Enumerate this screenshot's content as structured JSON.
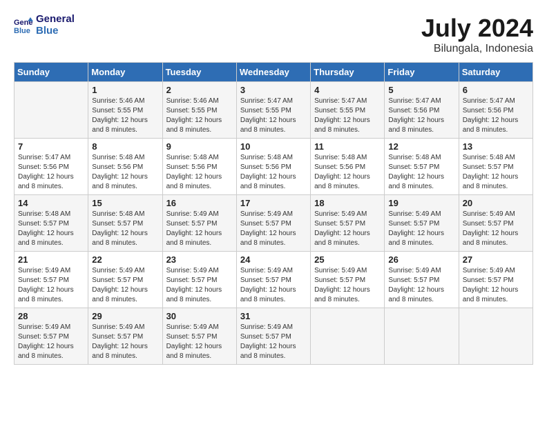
{
  "logo": {
    "line1": "General",
    "line2": "Blue"
  },
  "title": {
    "month_year": "July 2024",
    "location": "Bilungala, Indonesia"
  },
  "days_of_week": [
    "Sunday",
    "Monday",
    "Tuesday",
    "Wednesday",
    "Thursday",
    "Friday",
    "Saturday"
  ],
  "weeks": [
    [
      {
        "day": "",
        "info": ""
      },
      {
        "day": "1",
        "info": "Sunrise: 5:46 AM\nSunset: 5:55 PM\nDaylight: 12 hours\nand 8 minutes."
      },
      {
        "day": "2",
        "info": "Sunrise: 5:46 AM\nSunset: 5:55 PM\nDaylight: 12 hours\nand 8 minutes."
      },
      {
        "day": "3",
        "info": "Sunrise: 5:47 AM\nSunset: 5:55 PM\nDaylight: 12 hours\nand 8 minutes."
      },
      {
        "day": "4",
        "info": "Sunrise: 5:47 AM\nSunset: 5:55 PM\nDaylight: 12 hours\nand 8 minutes."
      },
      {
        "day": "5",
        "info": "Sunrise: 5:47 AM\nSunset: 5:56 PM\nDaylight: 12 hours\nand 8 minutes."
      },
      {
        "day": "6",
        "info": "Sunrise: 5:47 AM\nSunset: 5:56 PM\nDaylight: 12 hours\nand 8 minutes."
      }
    ],
    [
      {
        "day": "7",
        "info": "Sunrise: 5:47 AM\nSunset: 5:56 PM\nDaylight: 12 hours\nand 8 minutes."
      },
      {
        "day": "8",
        "info": "Sunrise: 5:48 AM\nSunset: 5:56 PM\nDaylight: 12 hours\nand 8 minutes."
      },
      {
        "day": "9",
        "info": "Sunrise: 5:48 AM\nSunset: 5:56 PM\nDaylight: 12 hours\nand 8 minutes."
      },
      {
        "day": "10",
        "info": "Sunrise: 5:48 AM\nSunset: 5:56 PM\nDaylight: 12 hours\nand 8 minutes."
      },
      {
        "day": "11",
        "info": "Sunrise: 5:48 AM\nSunset: 5:56 PM\nDaylight: 12 hours\nand 8 minutes."
      },
      {
        "day": "12",
        "info": "Sunrise: 5:48 AM\nSunset: 5:57 PM\nDaylight: 12 hours\nand 8 minutes."
      },
      {
        "day": "13",
        "info": "Sunrise: 5:48 AM\nSunset: 5:57 PM\nDaylight: 12 hours\nand 8 minutes."
      }
    ],
    [
      {
        "day": "14",
        "info": "Sunrise: 5:48 AM\nSunset: 5:57 PM\nDaylight: 12 hours\nand 8 minutes."
      },
      {
        "day": "15",
        "info": "Sunrise: 5:48 AM\nSunset: 5:57 PM\nDaylight: 12 hours\nand 8 minutes."
      },
      {
        "day": "16",
        "info": "Sunrise: 5:49 AM\nSunset: 5:57 PM\nDaylight: 12 hours\nand 8 minutes."
      },
      {
        "day": "17",
        "info": "Sunrise: 5:49 AM\nSunset: 5:57 PM\nDaylight: 12 hours\nand 8 minutes."
      },
      {
        "day": "18",
        "info": "Sunrise: 5:49 AM\nSunset: 5:57 PM\nDaylight: 12 hours\nand 8 minutes."
      },
      {
        "day": "19",
        "info": "Sunrise: 5:49 AM\nSunset: 5:57 PM\nDaylight: 12 hours\nand 8 minutes."
      },
      {
        "day": "20",
        "info": "Sunrise: 5:49 AM\nSunset: 5:57 PM\nDaylight: 12 hours\nand 8 minutes."
      }
    ],
    [
      {
        "day": "21",
        "info": "Sunrise: 5:49 AM\nSunset: 5:57 PM\nDaylight: 12 hours\nand 8 minutes."
      },
      {
        "day": "22",
        "info": "Sunrise: 5:49 AM\nSunset: 5:57 PM\nDaylight: 12 hours\nand 8 minutes."
      },
      {
        "day": "23",
        "info": "Sunrise: 5:49 AM\nSunset: 5:57 PM\nDaylight: 12 hours\nand 8 minutes."
      },
      {
        "day": "24",
        "info": "Sunrise: 5:49 AM\nSunset: 5:57 PM\nDaylight: 12 hours\nand 8 minutes."
      },
      {
        "day": "25",
        "info": "Sunrise: 5:49 AM\nSunset: 5:57 PM\nDaylight: 12 hours\nand 8 minutes."
      },
      {
        "day": "26",
        "info": "Sunrise: 5:49 AM\nSunset: 5:57 PM\nDaylight: 12 hours\nand 8 minutes."
      },
      {
        "day": "27",
        "info": "Sunrise: 5:49 AM\nSunset: 5:57 PM\nDaylight: 12 hours\nand 8 minutes."
      }
    ],
    [
      {
        "day": "28",
        "info": "Sunrise: 5:49 AM\nSunset: 5:57 PM\nDaylight: 12 hours\nand 8 minutes."
      },
      {
        "day": "29",
        "info": "Sunrise: 5:49 AM\nSunset: 5:57 PM\nDaylight: 12 hours\nand 8 minutes."
      },
      {
        "day": "30",
        "info": "Sunrise: 5:49 AM\nSunset: 5:57 PM\nDaylight: 12 hours\nand 8 minutes."
      },
      {
        "day": "31",
        "info": "Sunrise: 5:49 AM\nSunset: 5:57 PM\nDaylight: 12 hours\nand 8 minutes."
      },
      {
        "day": "",
        "info": ""
      },
      {
        "day": "",
        "info": ""
      },
      {
        "day": "",
        "info": ""
      }
    ]
  ]
}
